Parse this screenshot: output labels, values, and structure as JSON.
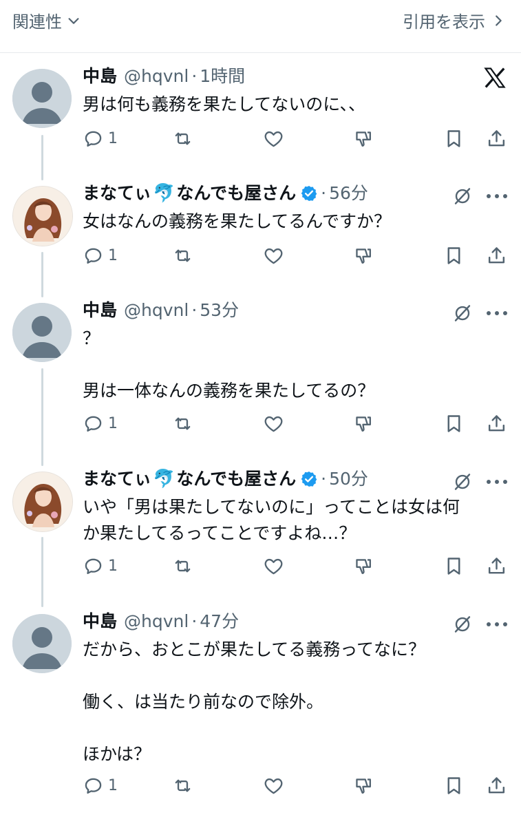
{
  "header": {
    "filter_label": "関連性",
    "quote_link": "引用を表示"
  },
  "tweets": [
    {
      "name": "中島",
      "handle": "@hqvnl",
      "time": "1時間",
      "lines": [
        "男は何も義務を果たしてないのに、、"
      ],
      "reply_count": "1"
    },
    {
      "name_a": "まなてぃ",
      "emoji": "🐬",
      "name_b": "なんでも屋さん",
      "time": "56分",
      "lines": [
        "女はなんの義務を果たしてるんですか？"
      ],
      "reply_count": "1"
    },
    {
      "name": "中島",
      "handle": "@hqvnl",
      "time": "53分",
      "lines": [
        "？",
        "",
        "男は一体なんの義務を果たしてるの？"
      ],
      "reply_count": "1"
    },
    {
      "name_a": "まなてぃ",
      "emoji": "🐬",
      "name_b": "なんでも屋さん",
      "time": "50分",
      "lines": [
        "いや「男は果たしてないのに」ってことは女は何",
        "か果たしてるってことですよね…？"
      ],
      "reply_count": "1"
    },
    {
      "name": "中島",
      "handle": "@hqvnl",
      "time": "47分",
      "lines": [
        "だから、おとこが果たしてる義務ってなに？",
        "",
        "働く、は当たり前なので除外。",
        "",
        "ほかは？"
      ],
      "reply_count": "1"
    }
  ],
  "colors": {
    "text": "#0f1419",
    "muted": "#536471",
    "verified": "#1d9bf0",
    "thread_line": "#cfd9de"
  }
}
